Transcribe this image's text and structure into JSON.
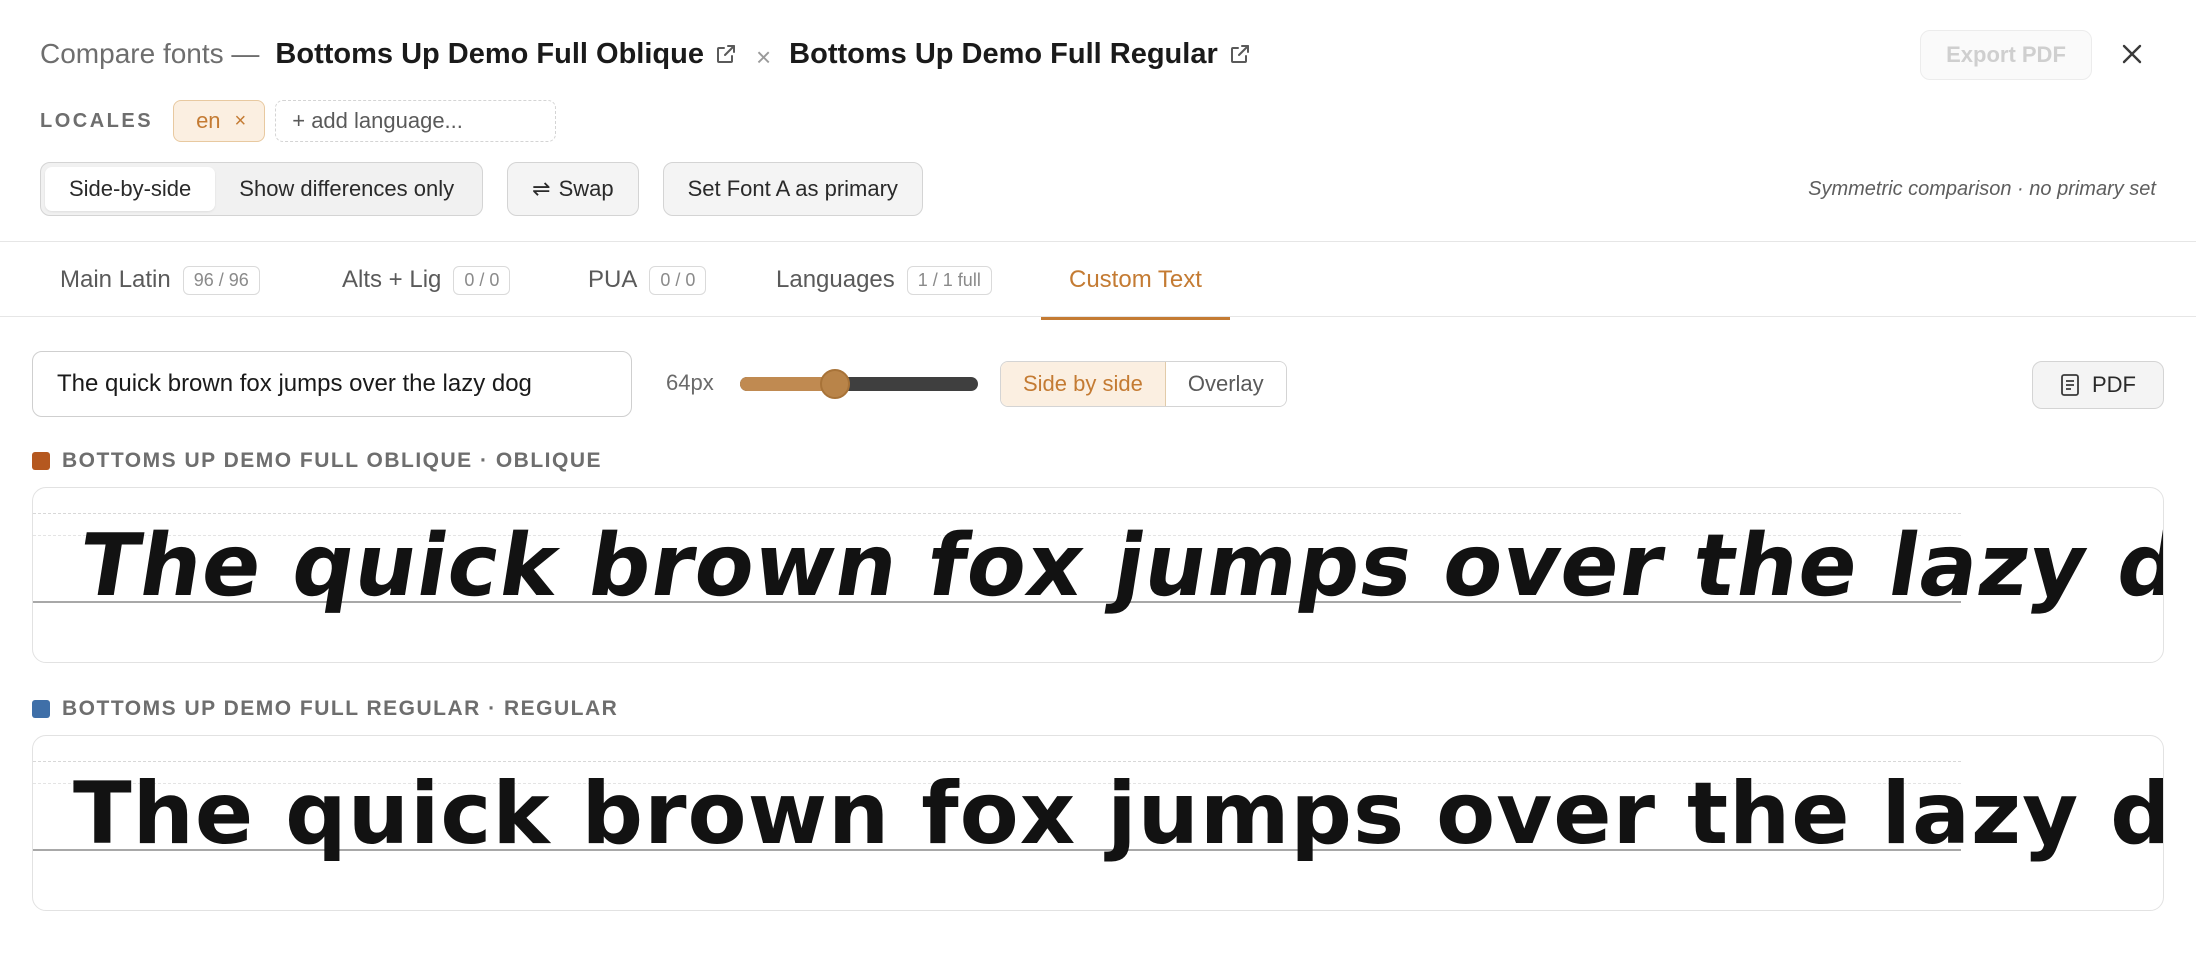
{
  "header": {
    "title_prefix": "Compare fonts —",
    "font_a_name": "Bottoms Up Demo Full Oblique",
    "font_b_name": "Bottoms Up Demo Full Regular",
    "separator": "×",
    "export_label": "Export PDF",
    "close_icon": "close-icon"
  },
  "locales": {
    "label": "LOCALES",
    "chips": [
      {
        "code": "en",
        "remove": "×"
      }
    ],
    "add_placeholder": "+ add language..."
  },
  "controls": {
    "view_modes": [
      "Side-by-side",
      "Show differences only"
    ],
    "active_view": "Side-by-side",
    "swap_label": "Swap",
    "primary_label": "Set Font A as primary",
    "note": "Symmetric comparison · no primary set"
  },
  "tabs": [
    {
      "label": "Main Latin",
      "count": "96 / 96"
    },
    {
      "label": "Alts + Lig",
      "count": "0 / 0"
    },
    {
      "label": "PUA",
      "count": "0 / 0"
    },
    {
      "label": "Languages",
      "count": "1 / 1 full"
    },
    {
      "label": "Custom Text",
      "count": ""
    }
  ],
  "active_tab": "Custom Text",
  "custom_text": {
    "input_value": "The quick brown fox jumps over the lazy dog",
    "size_label": "64px",
    "size_fraction": 0.4,
    "modes": [
      "Side by side",
      "Overlay"
    ],
    "active_mode": "Side by side",
    "pdf_label": "PDF"
  },
  "specimens": [
    {
      "label": "BOTTOMS UP DEMO FULL OBLIQUE · OBLIQUE",
      "color": "#b5581f",
      "sample": "The quick brown fox jumps over the lazy dog"
    },
    {
      "label": "BOTTOMS UP DEMO FULL REGULAR · REGULAR",
      "color": "#3f6fa8",
      "sample": "The quick brown fox jumps over the lazy dog"
    }
  ],
  "colors": {
    "accent": "#c47b33",
    "accent_bg": "#fbefe1"
  }
}
